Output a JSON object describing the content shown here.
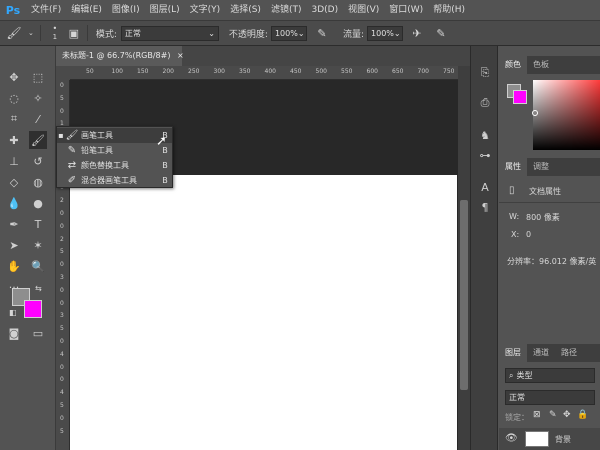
{
  "app": {
    "logo": "Ps"
  },
  "menu": [
    "文件(F)",
    "编辑(E)",
    "图像(I)",
    "图层(L)",
    "文字(Y)",
    "选择(S)",
    "滤镜(T)",
    "3D(D)",
    "视图(V)",
    "窗口(W)",
    "帮助(H)"
  ],
  "options": {
    "brush_size": "1",
    "mode_label": "模式:",
    "mode_value": "正常",
    "opacity_label": "不透明度:",
    "opacity_value": "100%",
    "flow_label": "流量:",
    "flow_value": "100%"
  },
  "document": {
    "tab_title": "未标题-1 @ 66.7%(RGB/8#)"
  },
  "ruler": {
    "top": [
      "50",
      "100",
      "150",
      "200",
      "250",
      "300",
      "350",
      "400",
      "450",
      "500",
      "550",
      "600",
      "650",
      "700",
      "750"
    ],
    "left": [
      "0",
      "5",
      "0",
      "1",
      "0",
      "0",
      "1",
      "5",
      "0",
      "2",
      "0",
      "0",
      "2",
      "5",
      "0",
      "3",
      "0",
      "0",
      "3",
      "5",
      "0",
      "4",
      "0",
      "0",
      "4",
      "5",
      "0",
      "5"
    ]
  },
  "flyout": {
    "items": [
      {
        "label": "画笔工具",
        "key": "B",
        "selected": true
      },
      {
        "label": "铅笔工具",
        "key": "B",
        "selected": false
      },
      {
        "label": "颜色替换工具",
        "key": "B",
        "selected": false
      },
      {
        "label": "混合器画笔工具",
        "key": "B",
        "selected": false
      }
    ]
  },
  "colors": {
    "foreground": "#8e8e8e",
    "background": "#ff00ff",
    "accent": "#31a8ff"
  },
  "color_panel": {
    "tab_color": "颜色",
    "tab_swatches": "色板"
  },
  "properties_panel": {
    "tab_properties": "属性",
    "tab_adjust": "调整",
    "heading": "文档属性",
    "w_label": "W:",
    "w_value": "800 像素",
    "x_label": "X:",
    "x_value": "0",
    "resolution": "分辨率：96.012 像素/英"
  },
  "layers_panel": {
    "tab_layers": "图层",
    "tab_channels": "通道",
    "tab_paths": "路径",
    "filter_placeholder": "类型",
    "blend_mode": "正常",
    "lock_label": "锁定：",
    "layer_name": "背景"
  }
}
